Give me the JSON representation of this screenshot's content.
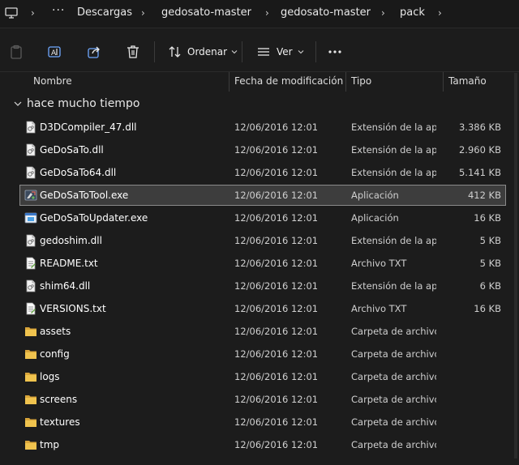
{
  "breadcrumb": {
    "items": [
      "Descargas",
      "gedosato-master",
      "gedosato-master",
      "pack"
    ]
  },
  "toolbar": {
    "sort_label": "Ordenar",
    "view_label": "Ver"
  },
  "columns": {
    "name": "Nombre",
    "date": "Fecha de modificación",
    "type": "Tipo",
    "size": "Tamaño"
  },
  "group": {
    "label": "hace mucho tiempo"
  },
  "files": [
    {
      "name": "D3DCompiler_47.dll",
      "date": "12/06/2016 12:01",
      "type": "Extensión de la aplicación",
      "size": "3.386 KB",
      "icon": "dll-file-icon"
    },
    {
      "name": "GeDoSaTo.dll",
      "date": "12/06/2016 12:01",
      "type": "Extensión de la aplicación",
      "size": "2.960 KB",
      "icon": "dll-file-icon"
    },
    {
      "name": "GeDoSaTo64.dll",
      "date": "12/06/2016 12:01",
      "type": "Extensión de la aplicación",
      "size": "5.141 KB",
      "icon": "dll-file-icon"
    },
    {
      "name": "GeDoSaToTool.exe",
      "date": "12/06/2016 12:01",
      "type": "Aplicación",
      "size": "412 KB",
      "icon": "exe-tool-icon"
    },
    {
      "name": "GeDoSaToUpdater.exe",
      "date": "12/06/2016 12:01",
      "type": "Aplicación",
      "size": "16 KB",
      "icon": "exe-window-icon"
    },
    {
      "name": "gedoshim.dll",
      "date": "12/06/2016 12:01",
      "type": "Extensión de la aplicación",
      "size": "5 KB",
      "icon": "dll-file-icon"
    },
    {
      "name": "README.txt",
      "date": "12/06/2016 12:01",
      "type": "Archivo TXT",
      "size": "5 KB",
      "icon": "txt-file-icon"
    },
    {
      "name": "shim64.dll",
      "date": "12/06/2016 12:01",
      "type": "Extensión de la aplicación",
      "size": "6 KB",
      "icon": "dll-file-icon"
    },
    {
      "name": "VERSIONS.txt",
      "date": "12/06/2016 12:01",
      "type": "Archivo TXT",
      "size": "16 KB",
      "icon": "txt-file-icon"
    },
    {
      "name": "assets",
      "date": "12/06/2016 12:01",
      "type": "Carpeta de archivos",
      "size": "",
      "icon": "folder-icon"
    },
    {
      "name": "config",
      "date": "12/06/2016 12:01",
      "type": "Carpeta de archivos",
      "size": "",
      "icon": "folder-icon"
    },
    {
      "name": "logs",
      "date": "12/06/2016 12:01",
      "type": "Carpeta de archivos",
      "size": "",
      "icon": "folder-icon"
    },
    {
      "name": "screens",
      "date": "12/06/2016 12:01",
      "type": "Carpeta de archivos",
      "size": "",
      "icon": "folder-icon"
    },
    {
      "name": "textures",
      "date": "12/06/2016 12:01",
      "type": "Carpeta de archivos",
      "size": "",
      "icon": "folder-icon"
    },
    {
      "name": "tmp",
      "date": "12/06/2016 12:01",
      "type": "Carpeta de archivos",
      "size": "",
      "icon": "folder-icon"
    }
  ],
  "selected_index": 3,
  "colors": {
    "background": "#1c1c1c",
    "folder": "#e8b94a",
    "selected_row": "#3d3d3d"
  }
}
